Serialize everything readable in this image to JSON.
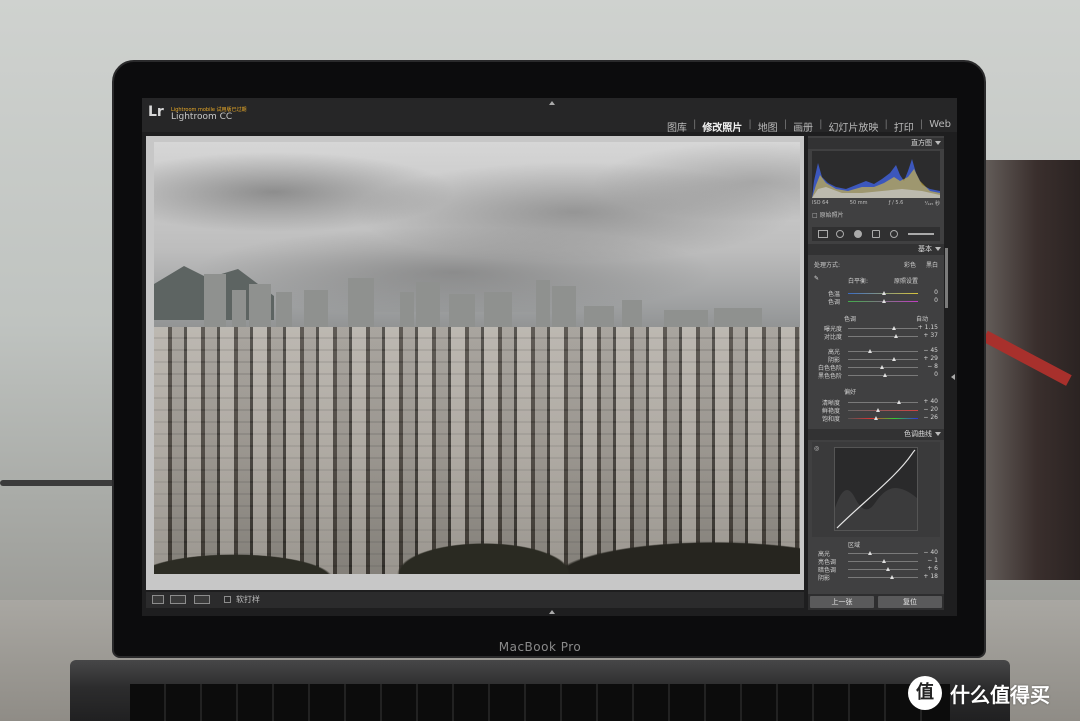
{
  "lightroom": {
    "logo": "Lr",
    "mobile_notice": "Lightroom mobile 试用版已过期",
    "app_name": "Lightroom CC",
    "modules": [
      "图库",
      "修改照片",
      "地图",
      "画册",
      "幻灯片放映",
      "打印",
      "Web"
    ],
    "active_module": "修改照片",
    "separator": "|"
  },
  "histogram": {
    "title": "直方图",
    "iso": "ISO 64",
    "focal": "50 mm",
    "aperture": "ƒ / 5.6",
    "shutter": "¹⁄₁₂₅ 秒",
    "original_label": "原始照片"
  },
  "basic": {
    "title": "基本",
    "treatment_label": "处理方式:",
    "treatment_color": "彩色",
    "treatment_bw": "黑白",
    "wb_label": "白平衡:",
    "wb_value": "原照设置",
    "temp_label": "色温",
    "temp_value": "0",
    "tint_label": "色调",
    "tint_value": "0",
    "tone_label": "色调",
    "auto_label": "自动",
    "exposure_label": "曝光度",
    "exposure_value": "+ 1.15",
    "contrast_label": "对比度",
    "contrast_value": "+ 37",
    "highlights_label": "高光",
    "highlights_value": "− 45",
    "shadows_label": "阴影",
    "shadows_value": "+ 29",
    "whites_label": "白色色阶",
    "whites_value": "− 8",
    "blacks_label": "黑色色阶",
    "blacks_value": "0",
    "presence_label": "偏好",
    "clarity_label": "清晰度",
    "clarity_value": "+ 40",
    "vibrance_label": "鲜艳度",
    "vibrance_value": "− 20",
    "saturation_label": "饱和度",
    "saturation_value": "− 26"
  },
  "tone_curve": {
    "title": "色调曲线",
    "region_label": "区域",
    "highlights_label": "高光",
    "highlights_value": "− 40",
    "lights_label": "亮色调",
    "lights_value": "− 1",
    "darks_label": "暗色调",
    "darks_value": "+ 6",
    "shadows_label": "阴影",
    "shadows_value": "+ 18"
  },
  "buttons": {
    "previous": "上一张",
    "reset": "复位"
  },
  "toolbar": {
    "soft_proof": "软打样"
  },
  "laptop": {
    "brand": "MacBook Pro"
  },
  "watermark": {
    "symbol": "值",
    "text": "什么值得买"
  }
}
